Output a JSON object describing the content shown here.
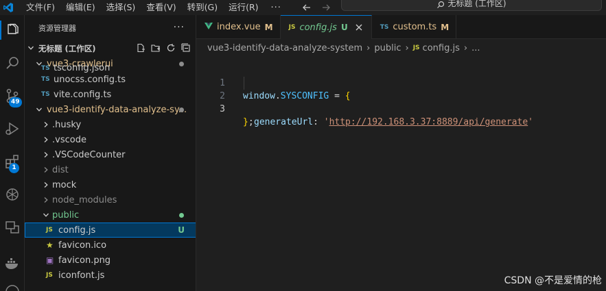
{
  "menu": {
    "items": [
      "文件(F)",
      "编辑(E)",
      "选择(S)",
      "查看(V)",
      "转到(G)",
      "运行(R)"
    ],
    "more": "···"
  },
  "command_center": {
    "text": "无标题 (工作区)"
  },
  "activity_bar": {
    "source_control_badge": "49",
    "extensions_badge": "1"
  },
  "sidebar": {
    "title": "资源管理器",
    "more": "···",
    "workspace": "无标题 (工作区)",
    "tree": [
      {
        "label": "vue3-crawlerui",
        "kind": "root",
        "color": "#e2c08d",
        "dot": "#8c8c8c"
      },
      {
        "label": "tsconfig.json",
        "kind": "file",
        "icon": "TS",
        "iconColor": "#519aba",
        "color": "#cccccc"
      },
      {
        "label": "unocss.config.ts",
        "kind": "file",
        "icon": "TS",
        "iconColor": "#519aba",
        "color": "#cccccc"
      },
      {
        "label": "vite.config.ts",
        "kind": "file",
        "icon": "TS",
        "iconColor": "#519aba",
        "color": "#cccccc"
      },
      {
        "label": "vue3-identify-data-analyze-sy...",
        "kind": "root",
        "color": "#e2c08d",
        "dot": "#8c8c8c"
      },
      {
        "label": ".husky",
        "kind": "folder",
        "color": "#cccccc"
      },
      {
        "label": ".vscode",
        "kind": "folder",
        "color": "#cccccc"
      },
      {
        "label": ".VSCodeCounter",
        "kind": "folder",
        "color": "#cccccc"
      },
      {
        "label": "dist",
        "kind": "folder",
        "color": "#8c8c8c"
      },
      {
        "label": "mock",
        "kind": "folder",
        "color": "#cccccc"
      },
      {
        "label": "node_modules",
        "kind": "folder",
        "color": "#8c8c8c"
      },
      {
        "label": "public",
        "kind": "folder-open",
        "color": "#73c991",
        "dot": "#73c991"
      },
      {
        "label": "config.js",
        "kind": "file",
        "icon": "JS",
        "iconColor": "#cbcb41",
        "color": "#cccccc",
        "git": "U",
        "selected": true
      },
      {
        "label": "favicon.ico",
        "kind": "file",
        "icon": "★",
        "iconColor": "#cbcb41",
        "color": "#cccccc"
      },
      {
        "label": "favicon.png",
        "kind": "file",
        "icon": "▣",
        "iconColor": "#a074c4",
        "color": "#cccccc"
      },
      {
        "label": "iconfont.js",
        "kind": "file",
        "icon": "JS",
        "iconColor": "#cbcb41",
        "color": "#cccccc"
      }
    ]
  },
  "tabs": [
    {
      "label": "index.vue",
      "icon": "V",
      "iconColor": "#41b883",
      "color": "#e2c08d",
      "status": "M",
      "statusColor": "#e2c08d",
      "italic": false,
      "active": false
    },
    {
      "label": "config.js",
      "icon": "JS",
      "iconColor": "#cbcb41",
      "color": "#73c991",
      "status": "U",
      "statusColor": "#73c991",
      "italic": true,
      "active": true
    },
    {
      "label": "custom.ts",
      "icon": "TS",
      "iconColor": "#519aba",
      "color": "#e2c08d",
      "status": "M",
      "statusColor": "#e2c08d",
      "italic": false,
      "active": false
    }
  ],
  "breadcrumbs": {
    "project": "vue3-identify-data-analyze-system",
    "folder": "public",
    "file_icon": "JS",
    "file": "config.js",
    "tail": "..."
  },
  "editor": {
    "line_numbers": [
      "1",
      "2",
      "3"
    ],
    "line1": {
      "var": "window",
      "dot": ".",
      "const": "SYSCONFIG",
      "op": " = ",
      "brace": "{"
    },
    "line2": {
      "key": "generateUrl",
      "colon": ": ",
      "q1": "'",
      "url": "http://192.168.3.37:8889/api/generate",
      "q2": "'"
    },
    "line3": {
      "brace": "}",
      "semi": ";"
    },
    "watermark": "CSDN @不是爱情的枪"
  }
}
